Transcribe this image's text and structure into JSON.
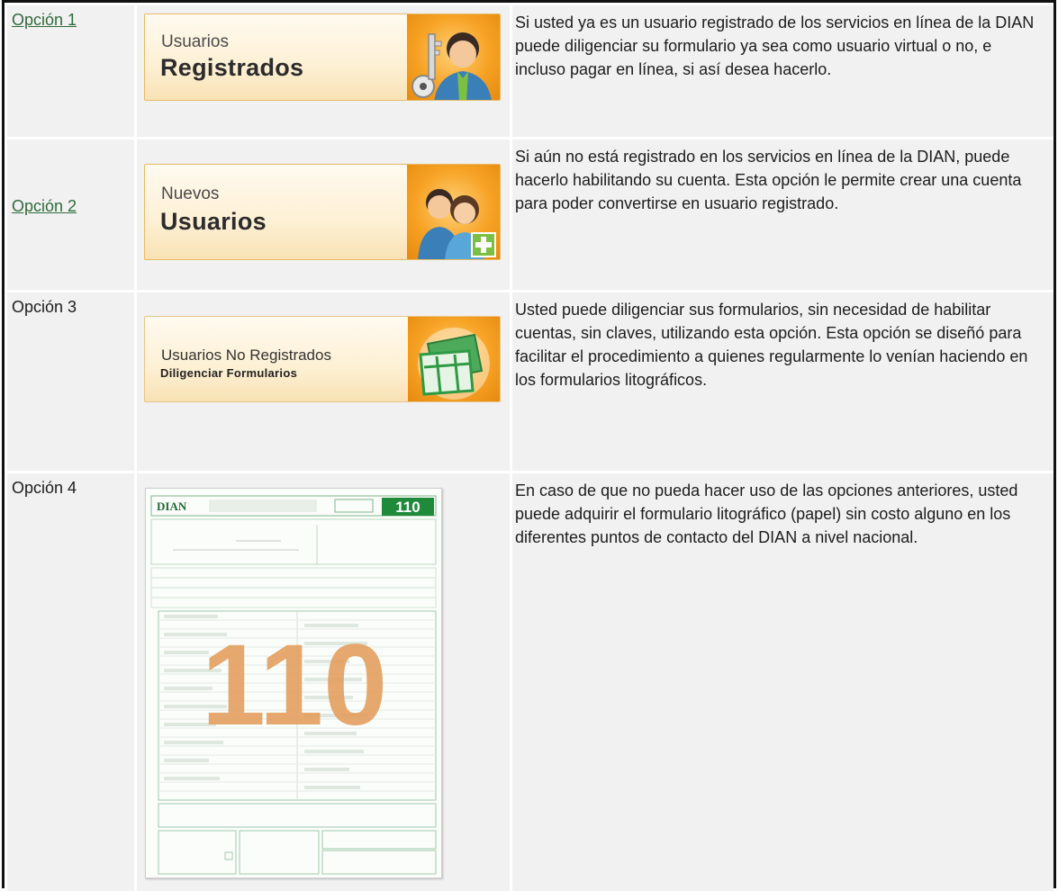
{
  "rows": [
    {
      "option": "Opción 1",
      "banner_line1": "Usuarios",
      "banner_line2": "Registrados",
      "icon": "user-key-icon",
      "description": "Si usted ya es un usuario registrado de los servicios en línea de la DIAN puede diligenciar su formulario ya sea como usuario virtual o no, e incluso pagar en línea, si así desea hacerlo."
    },
    {
      "option": "Opción 2",
      "banner_line1": "Nuevos",
      "banner_line2": "Usuarios",
      "icon": "add-users-icon",
      "description": "Si aún no está registrado en los servicios en línea de la DIAN, puede hacerlo habilitando su cuenta. Esta opción le permite crear una cuenta para poder convertirse en usuario registrado."
    },
    {
      "option": "Opción 3",
      "banner_line1": "Usuarios No Registrados",
      "banner_line2": "Diligenciar Formularios",
      "icon": "forms-icon",
      "description": "Usted puede diligenciar sus formularios, sin necesidad de habilitar cuentas, sin claves, utilizando esta opción. Esta opción se diseñó para facilitar el procedimiento a quienes regularmente lo venían haciendo en los formularios litográficos."
    },
    {
      "option": "Opción 4",
      "form_logo": "DIAN",
      "form_number": "110",
      "form_watermark": "110",
      "description": "En caso de que no pueda hacer uso de las opciones anteriores, usted puede adquirir el formulario litográfico (papel) sin costo alguno en los diferentes puntos de contacto del DIAN a nivel nacional."
    }
  ],
  "colors": {
    "cell_bg": "#f1f1f1",
    "link": "#2f6b3a",
    "banner_accent": "#f7a224",
    "form_green": "#1f8a3a",
    "watermark": "#e39a56"
  }
}
